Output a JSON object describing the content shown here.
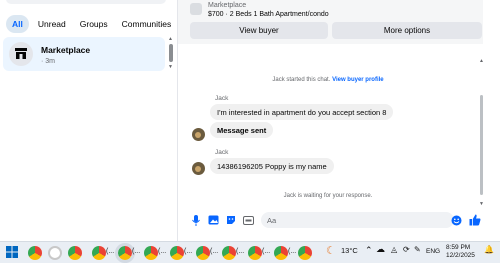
{
  "left": {
    "filters": [
      "All",
      "Unread",
      "Groups",
      "Communities"
    ],
    "conversation": {
      "name": "Marketplace",
      "time": "· 3m"
    }
  },
  "chat": {
    "listing": {
      "source": "Marketplace",
      "title": "$700 · 2 Beds 1 Bath Apartment/condo"
    },
    "buttons": {
      "view_buyer": "View buyer",
      "more_options": "More options"
    },
    "system_start": "Jack started this chat.",
    "system_link": "View buyer profile",
    "sender1": "Jack",
    "msg1": "I'm interested in apartment do you accept section 8",
    "msg2": "Message sent",
    "sender2": "Jack",
    "msg3": "14386196205 Poppy is my name",
    "system_wait": "Jack is waiting for your response.",
    "input_placeholder": "Aa"
  },
  "taskbar": {
    "weather": "13°C",
    "lang": "ENG",
    "time": "8:59 PM",
    "date": "12/2/2025"
  },
  "colors": {
    "accent": "#0866ff",
    "chip_bg": "#dbe7f2",
    "conv_bg": "#ebf5ff"
  }
}
